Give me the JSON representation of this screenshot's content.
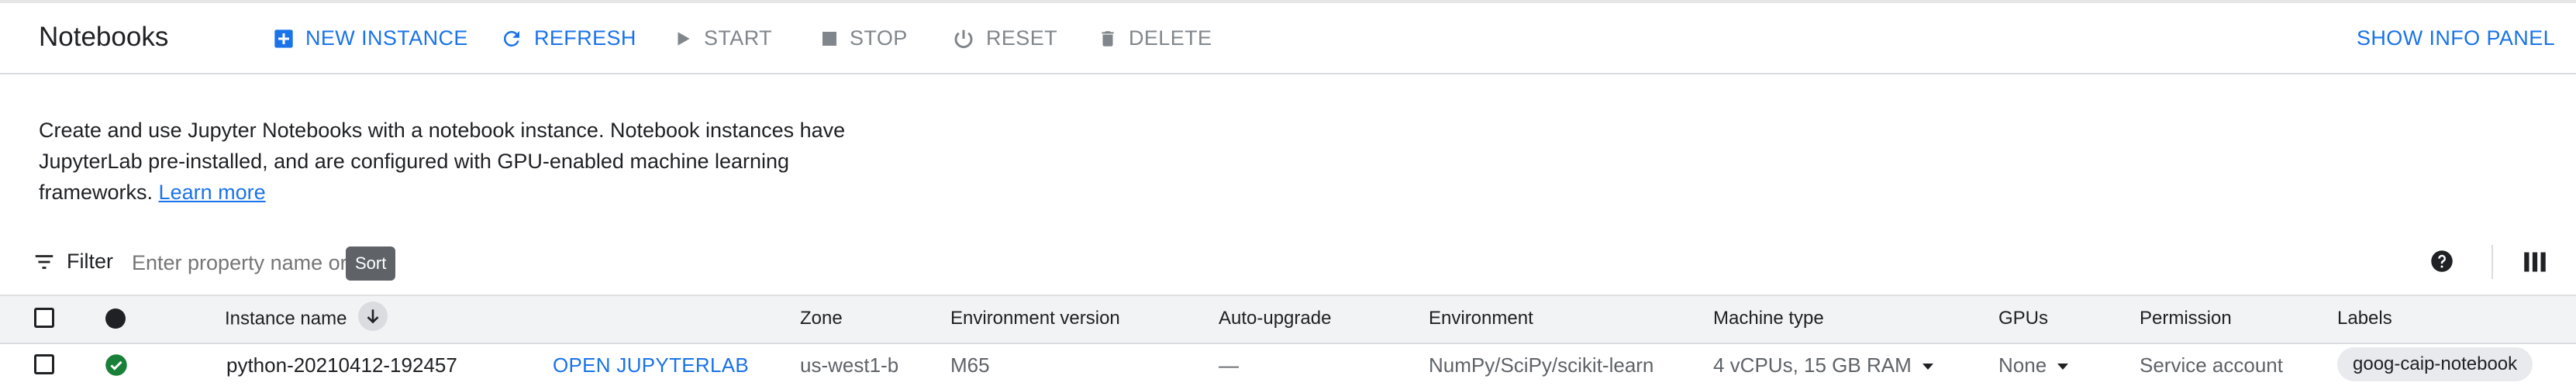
{
  "toolbar": {
    "title": "Notebooks",
    "new_instance": "NEW INSTANCE",
    "refresh": "REFRESH",
    "start": "START",
    "stop": "STOP",
    "reset": "RESET",
    "delete": "DELETE",
    "show_info_panel": "SHOW INFO PANEL"
  },
  "description": {
    "line1": "Create and use Jupyter Notebooks with a notebook instance. Notebook instances have",
    "line2": "JupyterLab pre-installed, and are configured with GPU-enabled machine learning",
    "line3": "frameworks.",
    "learn_more": "Learn more"
  },
  "filter": {
    "label": "Filter",
    "placeholder": "Enter property name or",
    "sort_tooltip": "Sort"
  },
  "table": {
    "headers": {
      "instance_name": "Instance name",
      "zone": "Zone",
      "environment_version": "Environment version",
      "auto_upgrade": "Auto-upgrade",
      "environment": "Environment",
      "machine_type": "Machine type",
      "gpus": "GPUs",
      "permission": "Permission",
      "labels": "Labels"
    },
    "rows": [
      {
        "name": "python-20210412-192457",
        "action": "OPEN JUPYTERLAB",
        "zone": "us-west1-b",
        "environment_version": "M65",
        "auto_upgrade": "—",
        "environment": "NumPy/SciPy/scikit-learn",
        "machine_type": "4 vCPUs, 15 GB RAM",
        "gpus": "None",
        "permission": "Service account",
        "label": "goog-caip-notebook"
      }
    ]
  },
  "colors": {
    "accent": "#1a73e8",
    "disabled": "#80868b",
    "status_ok": "#188038",
    "header_bg": "#f1f3f4"
  }
}
